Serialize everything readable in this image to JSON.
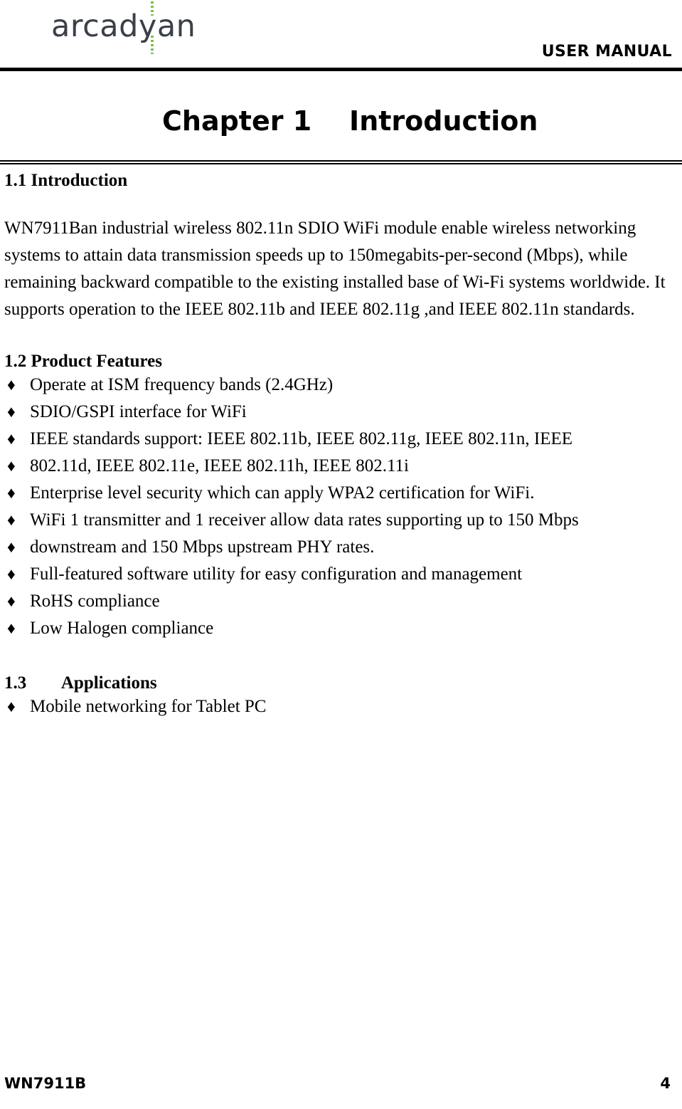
{
  "header": {
    "logo_text": "arcadyan",
    "logo_accent_color": "#7ac143",
    "logo_text_color": "#3a4049",
    "document_type": "USER MANUAL"
  },
  "chapter": {
    "title": "Chapter 1    Introduction"
  },
  "sections": {
    "s1_1": {
      "heading": "1.1 Introduction",
      "paragraph": "WN7911Ban industrial wireless 802.11n SDIO WiFi module enable wireless networking systems to attain data transmission speeds up to 150megabits-per-second (Mbps), while remaining backward compatible to the existing installed base of Wi-Fi systems worldwide. It supports operation to the IEEE 802.11b and IEEE 802.11g ,and    IEEE 802.11n standards."
    },
    "s1_2": {
      "heading": "1.2 Product Features",
      "bullet_glyph": "♦",
      "bullets": [
        "Operate at ISM frequency bands (2.4GHz)",
        "SDIO/GSPI interface for WiFi",
        "IEEE standards support: IEEE 802.11b, IEEE 802.11g, IEEE 802.11n, IEEE",
        "802.11d, IEEE 802.11e, IEEE 802.11h, IEEE 802.11i",
        "Enterprise level security which can apply WPA2 certification for WiFi.",
        "WiFi 1 transmitter and 1 receiver allow data rates supporting up to 150 Mbps",
        "downstream and 150 Mbps upstream PHY rates.",
        "Full-featured software utility for easy configuration and management",
        "RoHS compliance",
        "Low Halogen compliance"
      ]
    },
    "s1_3": {
      "heading": "1.3        Applications",
      "bullet_glyph": "♦",
      "bullets": [
        "Mobile networking for Tablet PC"
      ]
    }
  },
  "footer": {
    "model": "WN7911B",
    "page_number": "4"
  }
}
